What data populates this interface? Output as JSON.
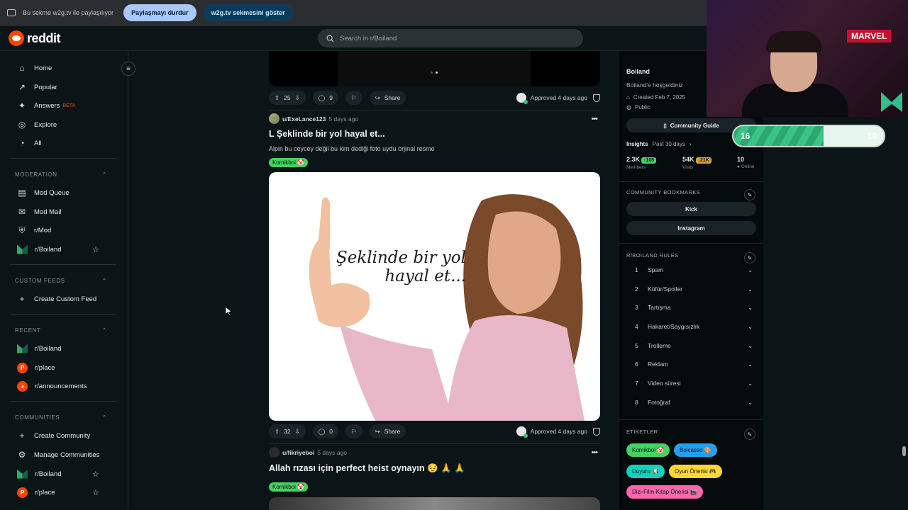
{
  "share_bar": {
    "text": "Bu sekme w2g.tv ile paylaşılıyor",
    "stop_label": "Paylaşmayı durdur",
    "show_label": "w2g.tv sekmesini göster"
  },
  "header": {
    "logo_text": "reddit",
    "search_placeholder": "Search in r/Boiland"
  },
  "sidebar": {
    "main": [
      {
        "label": "Home",
        "icon": "home-icon"
      },
      {
        "label": "Popular",
        "icon": "popular-icon"
      },
      {
        "label": "Answers",
        "icon": "answers-icon",
        "badge": "BETA"
      },
      {
        "label": "Explore",
        "icon": "explore-icon"
      },
      {
        "label": "All",
        "icon": "all-icon"
      }
    ],
    "moderation": {
      "heading": "MODERATION",
      "items": [
        {
          "label": "Mod Queue",
          "icon": "mod-queue-icon"
        },
        {
          "label": "Mod Mail",
          "icon": "mod-mail-icon"
        },
        {
          "label": "r/Mod",
          "icon": "mod-icon"
        },
        {
          "label": "r/Boiland",
          "icon": "boiland-icon"
        }
      ]
    },
    "custom_feeds": {
      "heading": "CUSTOM FEEDS",
      "items": [
        {
          "label": "Create Custom Feed",
          "icon": "plus-icon"
        }
      ]
    },
    "recent": {
      "heading": "RECENT",
      "items": [
        {
          "label": "r/Boiland",
          "icon": "boiland-icon"
        },
        {
          "label": "r/place",
          "icon": "place-icon"
        },
        {
          "label": "r/announcements",
          "icon": "announcements-icon"
        }
      ]
    },
    "communities": {
      "heading": "COMMUNITIES",
      "items": [
        {
          "label": "Create Community",
          "icon": "plus-icon"
        },
        {
          "label": "Manage Communities",
          "icon": "gear-icon"
        },
        {
          "label": "r/Boiland",
          "icon": "boiland-icon"
        },
        {
          "label": "r/place",
          "icon": "place-icon"
        }
      ]
    }
  },
  "feed": {
    "post0_actions": {
      "votes": "25",
      "comments": "9",
      "share": "Share",
      "approved": "Approved 4 days ago"
    },
    "post1": {
      "user": "u/ExeLance123",
      "time": "5 days ago",
      "title": "L Şeklinde bir yol hayal et...",
      "body": "Alpin bu ceycey değil bu kim dediği foto uydu orjinal resme",
      "flair": "Komikboi 🤡",
      "image_text_line1": "Şeklinde bir yol",
      "image_text_line2": "hayal et...",
      "votes": "32",
      "comments": "0",
      "share": "Share",
      "approved": "Approved 4 days ago"
    },
    "post2": {
      "user": "u/fikriyeboi",
      "time": "5 days ago",
      "title": "Allah rızası için perfect heist oynayın 😔 🙏 🙏",
      "flair": "Komikboi 🤡"
    }
  },
  "community": {
    "name": "Boiland",
    "welcome": "Boiland'e hoşgeldiniz",
    "created": "Created Feb 7, 2025",
    "visibility": "Public",
    "guide_label": "Community Guide",
    "insights_label": "Insights",
    "insights_period": "Past 30 days",
    "members_value": "2.3K",
    "members_delta": "↑105",
    "members_label": "Members",
    "visits_value": "54K",
    "visits_delta": "↓21K",
    "visits_label": "Visits",
    "online_value": "10",
    "online_label": "Online",
    "bookmarks_heading": "COMMUNITY BOOKMARKS",
    "bookmarks": [
      "Kick",
      "Instagram"
    ],
    "rules_heading": "R/BOILAND RULES",
    "rules": [
      "Spam",
      "Küfür/Spoiler",
      "Tartışma",
      "Hakaret/Saygısızlık",
      "Trolleme",
      "Reklam",
      "Video süresi",
      "Fotoğraf"
    ],
    "tags_heading": "ETIKETLER",
    "tags": [
      {
        "label": "Komikboi 🤡",
        "color": "#46d160"
      },
      {
        "label": "Boicasso 🎨",
        "color": "#24a0ed"
      },
      {
        "label": "Duyuru 📢",
        "color": "#0dd3bb"
      },
      {
        "label": "Oyun Önerisi 🎮",
        "color": "#ffd635"
      },
      {
        "label": "Dizi-Film-Kitap Önerisi 🎬",
        "color": "#ff66ac"
      }
    ]
  },
  "overlay": {
    "marvel_text": "MARVEL",
    "progress_left": "16",
    "progress_right": "10",
    "progress_fraction": 0.6
  }
}
